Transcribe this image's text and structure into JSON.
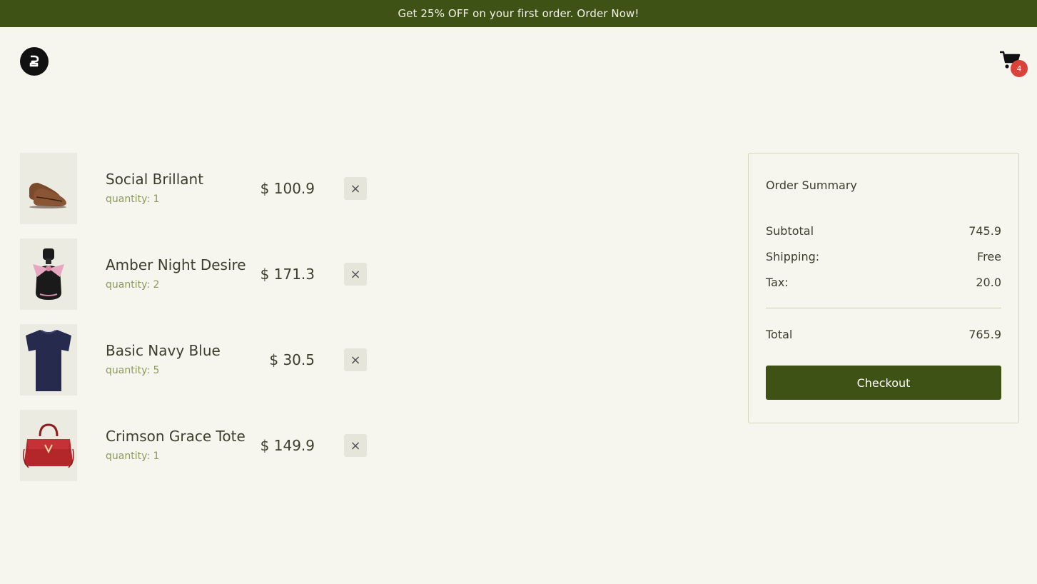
{
  "promo": {
    "text": "Get 25% OFF on your first order. Order Now!"
  },
  "header": {
    "logo_icon": "brand-logo-icon",
    "cart_icon": "shopping-cart-icon",
    "cart_count": "4"
  },
  "cart": {
    "currency": "$",
    "items": [
      {
        "name": "Social Brillant",
        "quantity_label": "quantity: 1",
        "price": "$ 100.9",
        "image": "brown-leather-shoes"
      },
      {
        "name": "Amber Night Desire",
        "quantity_label": "quantity: 2",
        "price": "$ 171.3",
        "image": "perfume-bottle-with-pink-bow"
      },
      {
        "name": "Basic Navy Blue",
        "quantity_label": "quantity: 5",
        "price": "$ 30.5",
        "image": "navy-t-shirt"
      },
      {
        "name": "Crimson Grace Tote",
        "quantity_label": "quantity: 1",
        "price": "$ 149.9",
        "image": "red-handbag"
      }
    ],
    "remove_label": "×"
  },
  "summary": {
    "title": "Order Summary",
    "subtotal_label": "Subtotal",
    "subtotal_value": "745.9",
    "shipping_label": "Shipping:",
    "shipping_value": "Free",
    "tax_label": "Tax:",
    "tax_value": "20.0",
    "total_label": "Total",
    "total_value": "765.9",
    "checkout_label": "Checkout"
  },
  "colors": {
    "accent": "#3f5216",
    "background": "#f6f5ee",
    "badge": "#d9433a",
    "muted_text": "#8b9a5e"
  }
}
